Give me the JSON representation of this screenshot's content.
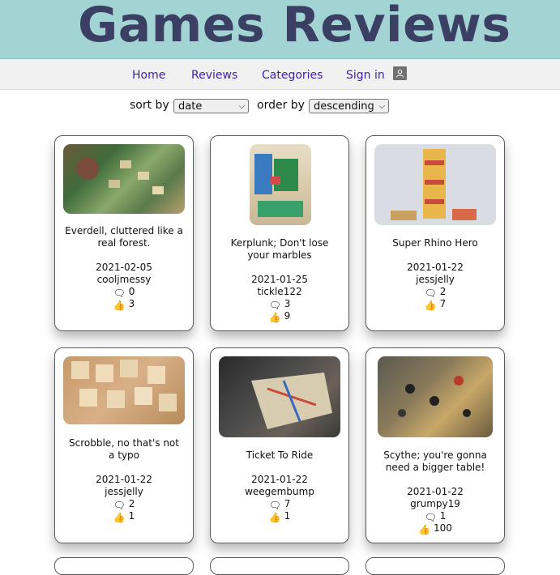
{
  "header": {
    "title": "Games Reviews"
  },
  "nav": {
    "home": "Home",
    "reviews": "Reviews",
    "categories": "Categories",
    "signin": "Sign in"
  },
  "sort": {
    "sort_label": "sort by",
    "sort_value": "date",
    "order_label": "order by",
    "order_value": "descending"
  },
  "reviews": [
    {
      "title": "Everdell, cluttered like a real forest.",
      "date": "2021-02-05",
      "author": "cooljmessy",
      "comments": "0",
      "votes": "3"
    },
    {
      "title": "Kerplunk; Don't lose your marbles",
      "date": "2021-01-25",
      "author": "tickle122",
      "comments": "3",
      "votes": "9"
    },
    {
      "title": "Super Rhino Hero",
      "date": "2021-01-22",
      "author": "jessjelly",
      "comments": "2",
      "votes": "7"
    },
    {
      "title": "Scrobble, no that's not a typo",
      "date": "2021-01-22",
      "author": "jessjelly",
      "comments": "2",
      "votes": "1"
    },
    {
      "title": "Ticket To Ride",
      "date": "2021-01-22",
      "author": "weegembump",
      "comments": "7",
      "votes": "1"
    },
    {
      "title": "Scythe; you're gonna need a bigger table!",
      "date": "2021-01-22",
      "author": "grumpy19",
      "comments": "1",
      "votes": "100"
    }
  ]
}
